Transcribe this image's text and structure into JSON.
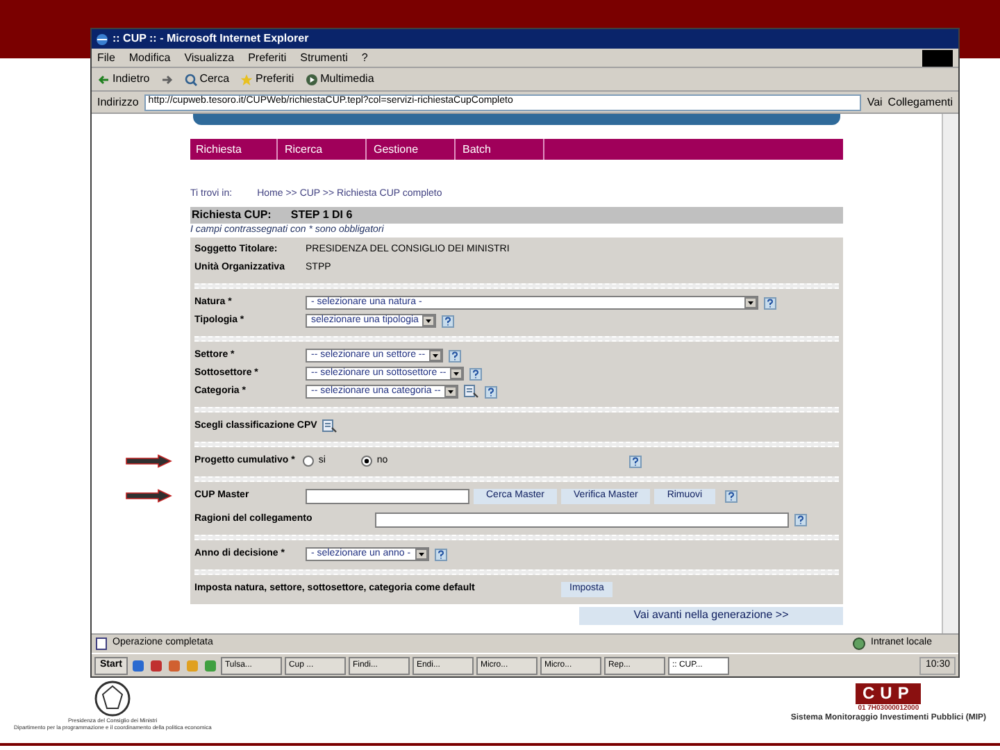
{
  "window": {
    "title": ":: CUP :: - Microsoft Internet Explorer"
  },
  "menu": [
    "File",
    "Modifica",
    "Visualizza",
    "Preferiti",
    "Strumenti",
    "?"
  ],
  "toolbar": [
    {
      "kind": "back",
      "label": "Indietro"
    },
    {
      "kind": "forward"
    },
    {
      "kind": "search",
      "label": "Cerca"
    },
    {
      "kind": "favorites",
      "label": "Preferiti"
    },
    {
      "kind": "media",
      "label": "Multimedia"
    }
  ],
  "address": {
    "label": "Indirizzo",
    "value": "http://cupweb.tesoro.it/CUPWeb/richiestaCUP.tepl?col=servizi-richiestaCupCompleto",
    "go": "Vai",
    "links": "Collegamenti"
  },
  "nav": [
    "Richiesta",
    "Ricerca",
    "Gestione",
    "Batch"
  ],
  "breadcrumb": {
    "label": "Ti trovi in:",
    "path": "Home >> CUP >> Richiesta CUP completo"
  },
  "heading": {
    "title": "Richiesta CUP:",
    "step": "STEP 1 DI 6"
  },
  "note": "I campi contrassegnati con * sono obbligatori",
  "sections": [
    [
      {
        "kind": "text",
        "label": "Soggetto Titolare:",
        "value": "PRESIDENZA DEL CONSIGLIO DEI MINISTRI"
      },
      {
        "kind": "text",
        "label": "Unità Organizzativa",
        "value": "STPP"
      }
    ],
    [
      {
        "kind": "select",
        "label": "Natura *",
        "value": "- selezionare una natura -",
        "wide": true
      },
      {
        "kind": "select",
        "label": "Tipologia *",
        "value": "selezionare una tipologia",
        "wide": false
      }
    ],
    [
      {
        "kind": "select",
        "label": "Settore *",
        "value": "-- selezionare un settore --",
        "wide": false
      },
      {
        "kind": "select",
        "label": "Sottosettore *",
        "value": "-- selezionare un sottosettore --",
        "wide": false
      },
      {
        "kind": "select",
        "label": "Categoria *",
        "value": "-- selezionare una categoria --",
        "wide": false,
        "lookup": true
      }
    ],
    [
      {
        "kind": "lookup",
        "label": "Scegli classificazione CPV"
      }
    ],
    [
      {
        "kind": "radio",
        "label": "Progetto cumulativo *",
        "options": [
          {
            "label": "si",
            "selected": false
          },
          {
            "label": "no",
            "selected": true
          }
        ],
        "arrow": true
      }
    ],
    [
      {
        "kind": "master",
        "label": "CUP Master",
        "buttons": [
          "Cerca Master",
          "Verifica Master",
          "Rimuovi"
        ],
        "arrow": true
      },
      {
        "kind": "field",
        "label": "Ragioni del collegamento"
      }
    ],
    [
      {
        "kind": "select",
        "label": "Anno di decisione *",
        "value": "- selezionare un anno -",
        "wide": false
      }
    ],
    [
      {
        "kind": "default",
        "label": "Imposta natura, settore, sottosettore, categoria come default",
        "button": "Imposta"
      }
    ]
  ],
  "next_button": "Vai avanti nella generazione >>",
  "status_bar": {
    "message": "Operazione completata",
    "zone": "Intranet locale"
  },
  "taskbar": {
    "start": "Start",
    "tasks": [
      "Tulsa...",
      "Cup ...",
      "Findi...",
      "Endi...",
      "Micro...",
      "Micro...",
      "Rep...",
      ":: CUP..."
    ],
    "clock": "10:30"
  },
  "footer": {
    "left": [
      "Presidenza del Consiglio dei Ministri",
      "Dipartimento per la programmazione e il coordinamento della politica economica"
    ],
    "logo": "CUP",
    "code": "01 7H03000012000",
    "caption": "Sistema Monitoraggio Investimenti Pubblici (MIP)"
  }
}
